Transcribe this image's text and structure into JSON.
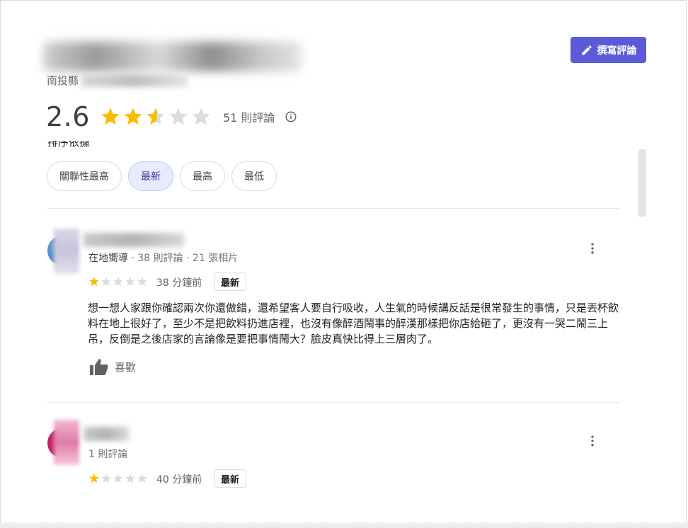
{
  "header": {
    "region": "南投縣",
    "write_review_label": "撰寫評論"
  },
  "rating": {
    "value": "2.6",
    "stars": 2.6,
    "count_label": "51 則評論"
  },
  "sort": {
    "label": "排序依據",
    "chips": [
      "關聯性最高",
      "最新",
      "最高",
      "最低"
    ],
    "selected": "最新"
  },
  "reviews": [
    {
      "meta_role": "在地嚮導",
      "meta_stats": " · 38 則評論 · 21 張相片",
      "stars": 1,
      "time": "38 分鐘前",
      "badge": "最新",
      "text": "想一想人家跟你確認兩次你還做錯，還希望客人要自行吸收，人生氣的時候講反話是很常發生的事情，只是丟杯飲料在地上很好了，至少不是把飲料扔進店裡，也沒有像醉酒鬧事的醉漢那樣把你店給砸了，更沒有一哭二鬧三上吊，反倒是之後店家的言論像是要把事情鬧大？臉皮真快比得上三層肉了。",
      "like_label": "喜歡"
    },
    {
      "meta_role": "",
      "meta_stats": "1 則評論",
      "stars": 1,
      "time": "40 分鐘前",
      "badge": "最新"
    }
  ],
  "colors": {
    "accent": "#5b5bd6",
    "star_filled": "#fbbc04",
    "star_empty": "#dadce0",
    "chip_active_bg": "#e8eaff"
  },
  "icons": {
    "write": "pencil-icon",
    "info": "info-icon",
    "more": "more-vert-icon",
    "like": "thumb-up-icon"
  }
}
